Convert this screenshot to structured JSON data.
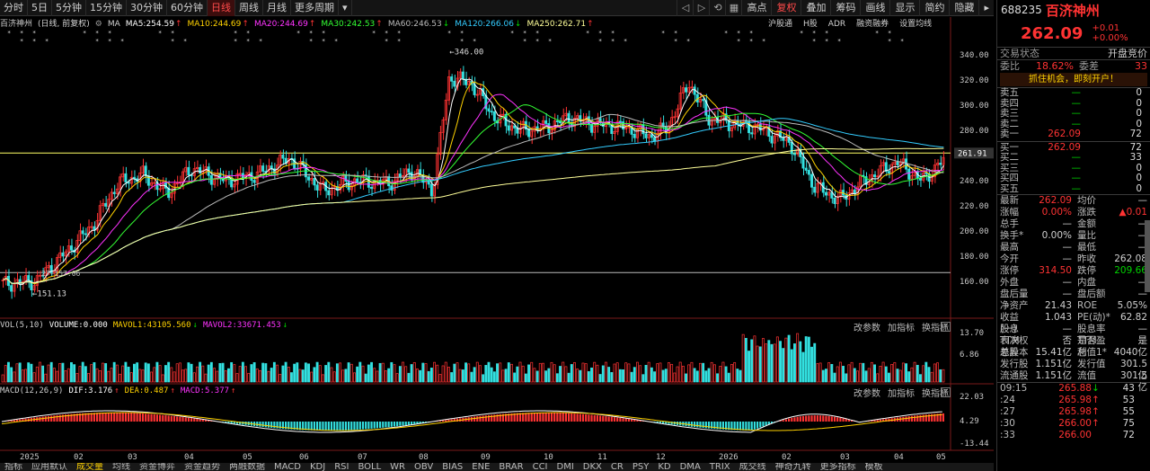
{
  "toolbar": {
    "periods": [
      "分时",
      "5日",
      "5分钟",
      "15分钟",
      "30分钟",
      "60分钟",
      "日线",
      "周线",
      "月线",
      "更多周期"
    ],
    "active_period": "日线",
    "right_buttons": [
      "复权",
      "叠加",
      "筹码",
      "画线",
      "显示",
      "简约",
      "隐藏"
    ],
    "highlight_button": "复权",
    "left_tool": "高点",
    "more_arrow": "▸"
  },
  "main_panel": {
    "stock_name": "百济神州",
    "mode": "(日线, 前复权)",
    "ma_label": "MA",
    "mas": [
      {
        "label": "MA5:254.59",
        "arrow": "↑",
        "color": "#ffffff"
      },
      {
        "label": "MA10:244.69",
        "arrow": "↑",
        "color": "#ffd200"
      },
      {
        "label": "MA20:244.69",
        "arrow": "↑",
        "color": "#ff33ff"
      },
      {
        "label": "MA30:242.53",
        "arrow": "↑",
        "color": "#33ff33"
      },
      {
        "label": "MA60:246.53",
        "arrow": "↓",
        "color": "#bbbbbb"
      },
      {
        "label": "MA120:266.06",
        "arrow": "↓",
        "color": "#33ccff"
      },
      {
        "label": "MA250:262.71",
        "arrow": "↑",
        "color": "#ffff99"
      }
    ],
    "right_tabs": [
      "沪股通",
      "H股",
      "ADR",
      "融资融券",
      "设置均线"
    ],
    "price_axis": [
      "340.00",
      "320.00",
      "300.00",
      "280.00",
      "260.00",
      "240.00",
      "220.00",
      "200.00",
      "180.00",
      "160.00"
    ],
    "current_price_tag": "261.91",
    "high_annotation": "346.00",
    "low_annotation": "151.13",
    "low_ref_annotation": "157.06",
    "low_ref_prefix": "27"
  },
  "volume_panel": {
    "title": "VOL(5,10)",
    "volume": "VOLUME:0.000",
    "vol1": "MAVOL1:43105.560",
    "vol2": "MAVOL2:33671.453",
    "vol2_arrow": "↓",
    "vol1_arrow": "↓",
    "axis": [
      "13.70",
      "6.86"
    ],
    "actions": [
      "改参数",
      "加指标",
      "换指标"
    ],
    "close": "×"
  },
  "macd_panel": {
    "title": "MACD(12,26,9)",
    "dif": "DIF:3.176",
    "dea": "DEA:0.487",
    "macd": "MACD:5.377",
    "dif_arrow": "↑",
    "dea_arrow": "↑",
    "macd_arrow": "↑",
    "axis": [
      "22.03",
      "4.29",
      "-13.44"
    ],
    "actions": [
      "改参数",
      "加指标",
      "换指标"
    ],
    "close": "×"
  },
  "x_axis": [
    "2025",
    "02",
    "03",
    "04",
    "05",
    "06",
    "07",
    "08",
    "09",
    "10",
    "11",
    "12",
    "2026",
    "02",
    "03",
    "04",
    "05"
  ],
  "bottom_tabs": [
    "指标",
    "应用默认",
    "成交量",
    "均线",
    "资金博弈",
    "资金趋势",
    "两融数据",
    "MACD",
    "KDJ",
    "RSI",
    "BOLL",
    "WR",
    "OBV",
    "BIAS",
    "ENE",
    "BRAR",
    "CCI",
    "DMI",
    "DKX",
    "CR",
    "PSY",
    "KD",
    "DMA",
    "TRIX",
    "成交线",
    "神奇九转",
    "更多指标",
    "模板"
  ],
  "active_bottom_tab": "成交量",
  "quote": {
    "code": "688235",
    "name": "百济神州",
    "price": "262.09",
    "change": "+0.01",
    "change_pct": "+0.00%",
    "status_label": "交易状态",
    "status_value": "开盘竞价",
    "weibi_label": "委比",
    "weibi_value": "18.62%",
    "weicha_label": "委差",
    "weicha_value": "33",
    "banner": "抓住机会，即刻开户！",
    "sells": [
      {
        "label": "卖五",
        "price": "—",
        "vol": "0"
      },
      {
        "label": "卖四",
        "price": "—",
        "vol": "0"
      },
      {
        "label": "卖三",
        "price": "—",
        "vol": "0"
      },
      {
        "label": "卖二",
        "price": "—",
        "vol": "0"
      },
      {
        "label": "卖一",
        "price": "262.09",
        "vol": "72"
      }
    ],
    "buys": [
      {
        "label": "买一",
        "price": "262.09",
        "vol": "72"
      },
      {
        "label": "买二",
        "price": "—",
        "vol": "33"
      },
      {
        "label": "买三",
        "price": "—",
        "vol": "0"
      },
      {
        "label": "买四",
        "price": "—",
        "vol": "0"
      },
      {
        "label": "买五",
        "price": "—",
        "vol": "0"
      }
    ],
    "stats": [
      {
        "l1": "最新",
        "v1": "262.09",
        "c1": "c-red",
        "l2": "均价",
        "v2": "—",
        "c2": "c-white"
      },
      {
        "l1": "涨幅",
        "v1": "0.00%",
        "c1": "c-red",
        "l2": "涨跌",
        "v2": "▲0.01",
        "c2": "c-red"
      },
      {
        "l1": "总手",
        "v1": "—",
        "c1": "c-white",
        "l2": "金额",
        "v2": "—",
        "c2": "c-white"
      },
      {
        "l1": "换手*",
        "v1": "0.00%",
        "c1": "c-white",
        "l2": "量比",
        "v2": "—",
        "c2": "c-white"
      },
      {
        "l1": "最高",
        "v1": "—",
        "c1": "c-white",
        "l2": "最低",
        "v2": "—",
        "c2": "c-white"
      },
      {
        "l1": "今开",
        "v1": "—",
        "c1": "c-white",
        "l2": "昨收",
        "v2": "262.08",
        "c2": "c-white"
      },
      {
        "l1": "涨停",
        "v1": "314.50",
        "c1": "c-red",
        "l2": "跌停",
        "v2": "209.66",
        "c2": "c-green"
      },
      {
        "l1": "外盘",
        "v1": "—",
        "c1": "c-white",
        "l2": "内盘",
        "v2": "—",
        "c2": "c-white"
      },
      {
        "l1": "盘后量",
        "v1": "—",
        "c1": "c-white",
        "l2": "盘后额",
        "v2": "—",
        "c2": "c-white"
      },
      {
        "l1": "净资产",
        "v1": "21.43",
        "c1": "c-white",
        "l2": "ROE",
        "v2": "5.05%",
        "c2": "c-white"
      },
      {
        "l1": "收益(一)",
        "v1": "1.043",
        "c1": "c-white",
        "l2": "PE(动)*",
        "v2": "62.82",
        "c2": "c-white"
      },
      {
        "l1": "股息TTM",
        "v1": "—",
        "c1": "c-white",
        "l2": "股息率TTM",
        "v2": "—",
        "c2": "c-white"
      },
      {
        "l1": "表决权差异",
        "v1": "否",
        "c1": "c-white",
        "l2": "是否盈利",
        "v2": "是",
        "c2": "c-white"
      },
      {
        "l1": "总股本",
        "v1": "15.41亿",
        "c1": "c-white",
        "l2": "总值1*",
        "v2": "4040亿",
        "c2": "c-white"
      },
      {
        "l1": "发行股",
        "v1": "1.151亿",
        "c1": "c-white",
        "l2": "发行值",
        "v2": "301.5亿",
        "c2": "c-white"
      },
      {
        "l1": "流通股",
        "v1": "1.151亿",
        "c1": "c-white",
        "l2": "流值",
        "v2": "301.5亿",
        "c2": "c-white"
      }
    ],
    "ticks": [
      {
        "time": "09:15",
        "price": "265.88",
        "arrow": "↓",
        "vol": "43"
      },
      {
        "time": ":24",
        "price": "265.98",
        "arrow": "↑",
        "vol": "53"
      },
      {
        "time": ":27",
        "price": "265.98",
        "arrow": "↑",
        "vol": "55"
      },
      {
        "time": ":30",
        "price": "266.00",
        "arrow": "↑",
        "vol": "75"
      },
      {
        "time": ":33",
        "price": "266.00",
        "arrow": "",
        "vol": "72"
      }
    ]
  }
}
